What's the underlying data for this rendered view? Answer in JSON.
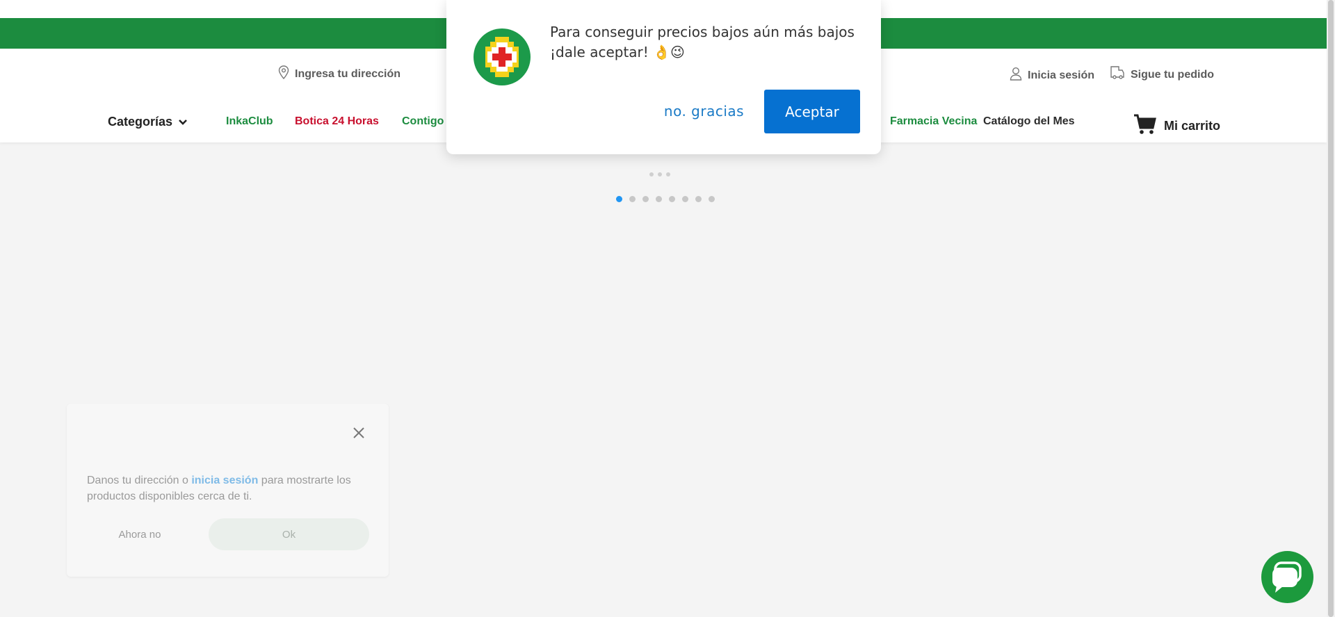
{
  "colors": {
    "brand_green": "#1c8c3f",
    "accent_red": "#c8102e",
    "primary_blue": "#0671d1",
    "link_blue": "#7fbbe7",
    "page_bg": "#f4f4f4"
  },
  "header": {
    "address_label": "Ingresa tu dirección",
    "address_icon": "location-pin-icon",
    "login_label": "Inicia sesión",
    "login_icon": "user-icon",
    "track_label": "Sigue tu pedido",
    "track_icon": "package-tracking-icon"
  },
  "nav": {
    "categories_label": "Categorías",
    "links": [
      {
        "label": "InkaClub"
      },
      {
        "label": "Botica 24 Horas"
      },
      {
        "label": "Contigo I"
      },
      {
        "label": "Farmacia Vecina"
      },
      {
        "label": "Catálogo del Mes"
      }
    ],
    "cart_label": "Mi carrito",
    "cart_icon": "cart-icon"
  },
  "carousel": {
    "loading_dots": 3,
    "page_count": 8,
    "active_page": 1
  },
  "notification_modal": {
    "message": "Para conseguir precios bajos aún más bajos ¡dale aceptar! 👌😉",
    "decline_label": "no. gracias",
    "accept_label": "Aceptar",
    "logo_icon": "inkafarma-logo-icon"
  },
  "address_popup": {
    "text_before": "Danos tu dirección o ",
    "link_text": "inicia sesión",
    "text_after": " para mostrarte los productos disponibles cerca de ti.",
    "later_label": "Ahora no",
    "ok_label": "Ok",
    "close_icon": "close-icon"
  },
  "chat": {
    "icon": "chat-bubble-icon"
  }
}
